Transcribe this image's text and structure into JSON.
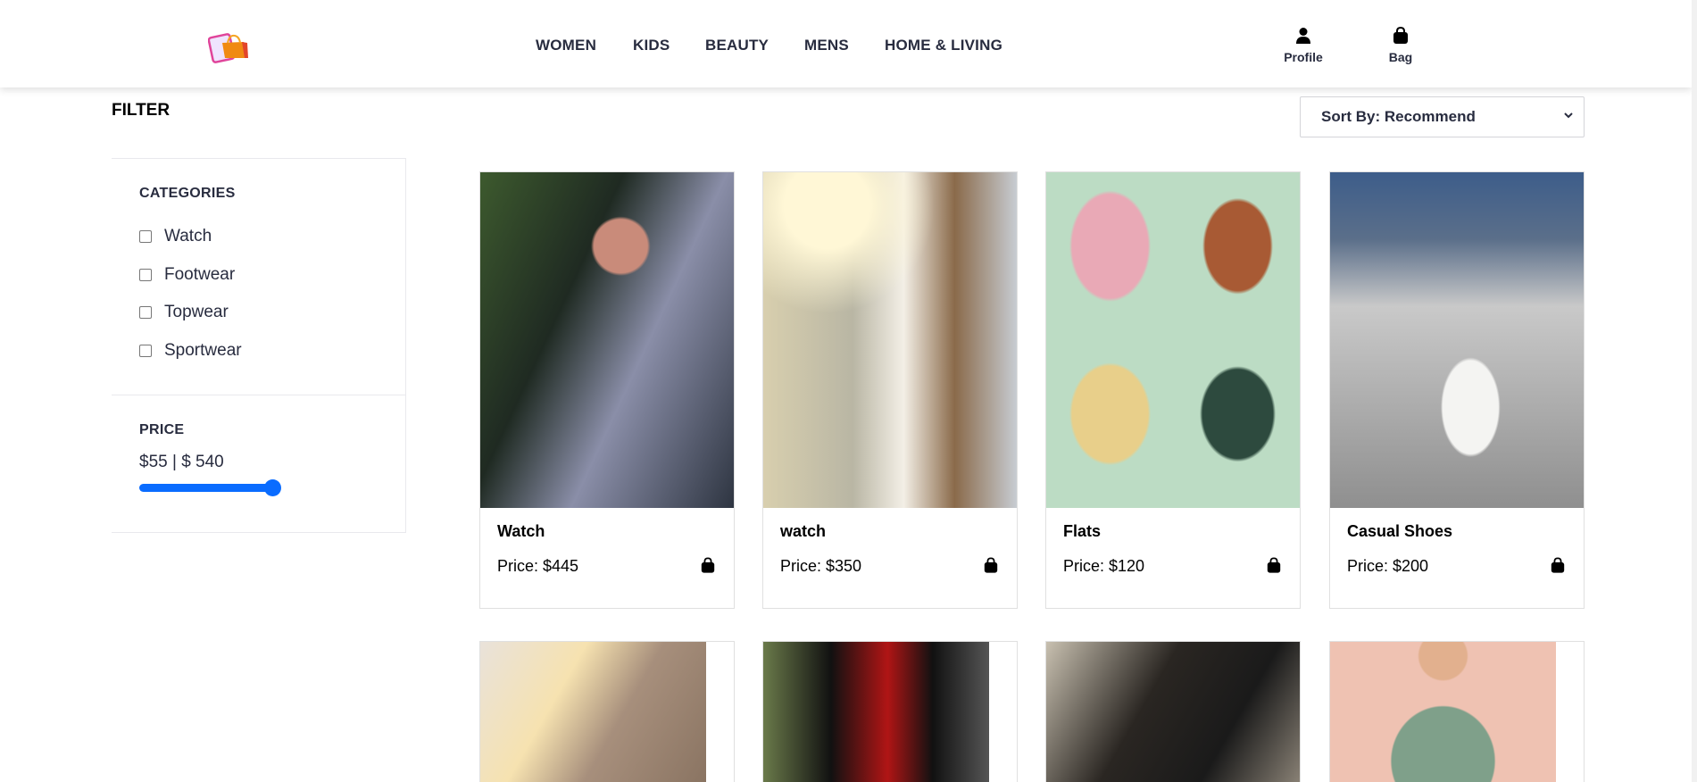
{
  "header": {
    "nav": [
      "WOMEN",
      "KIDS",
      "BEAUTY",
      "MENS",
      "HOME & LIVING"
    ],
    "profile_label": "Profile",
    "bag_label": "Bag"
  },
  "filter": {
    "title": "FILTER",
    "categories_title": "CATEGORIES",
    "categories": [
      "Watch",
      "Footwear",
      "Topwear",
      "Sportwear"
    ],
    "price_title": "PRICE",
    "price_range": "$55 | $ 540",
    "slider_value": 540,
    "slider_min": 55,
    "slider_max": 540
  },
  "sort": {
    "label": "Sort By: Recommend"
  },
  "accent": "#0a6cff",
  "products": [
    {
      "name": "Watch",
      "price": "Price: $445"
    },
    {
      "name": "watch",
      "price": "Price: $350"
    },
    {
      "name": "Flats",
      "price": "Price: $120"
    },
    {
      "name": "Casual Shoes",
      "price": "Price: $200"
    },
    {},
    {},
    {},
    {}
  ]
}
